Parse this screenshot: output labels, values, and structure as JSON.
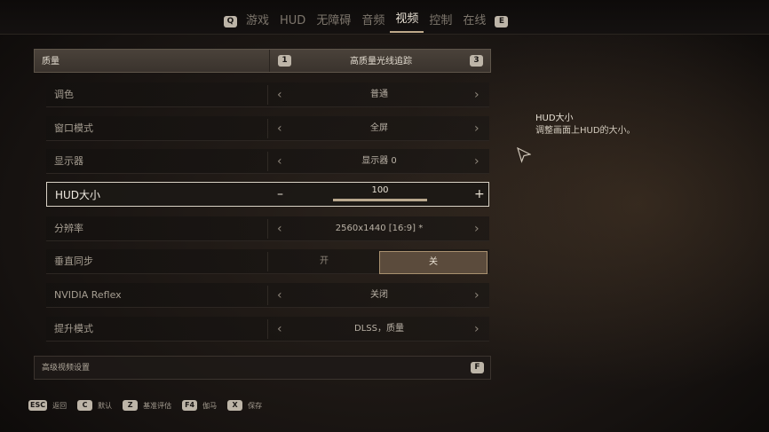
{
  "tabs": {
    "left_key": "Q",
    "right_key": "E",
    "items": [
      "游戏",
      "HUD",
      "无障碍",
      "音频",
      "视频",
      "控制",
      "在线"
    ],
    "active": "视频"
  },
  "quality": {
    "label": "质量",
    "prev_key": "1",
    "value": "高质量光线追踪",
    "next_key": "3"
  },
  "settings": {
    "tone": {
      "label": "调色",
      "value": "普通"
    },
    "window_mode": {
      "label": "窗口模式",
      "value": "全屏"
    },
    "display": {
      "label": "显示器",
      "value": "显示器 0"
    },
    "hud_size": {
      "label": "HUD大小",
      "value": "100",
      "minus": "–",
      "plus": "+",
      "level_fraction": 1.0
    },
    "resolution": {
      "label": "分辨率",
      "value": "2560x1440 [16:9] *"
    },
    "vsync": {
      "label": "垂直同步",
      "on": "开",
      "off": "关",
      "selected": "关"
    },
    "reflex": {
      "label": "NVIDIA Reflex",
      "value": "关闭"
    },
    "upscale": {
      "label": "提升模式",
      "value": "DLSS，质量"
    }
  },
  "arrows": {
    "left": "‹",
    "right": "›"
  },
  "advanced": {
    "label": "高级视频设置",
    "key": "F"
  },
  "help": {
    "title": "HUD大小",
    "description": "调整画面上HUD的大小。"
  },
  "footer": [
    {
      "key": "ESC",
      "label": "返回"
    },
    {
      "key": "C",
      "label": "默认"
    },
    {
      "key": "Z",
      "label": "基准评估"
    },
    {
      "key": "F4",
      "label": "伽马"
    },
    {
      "key": "X",
      "label": "保存"
    }
  ]
}
